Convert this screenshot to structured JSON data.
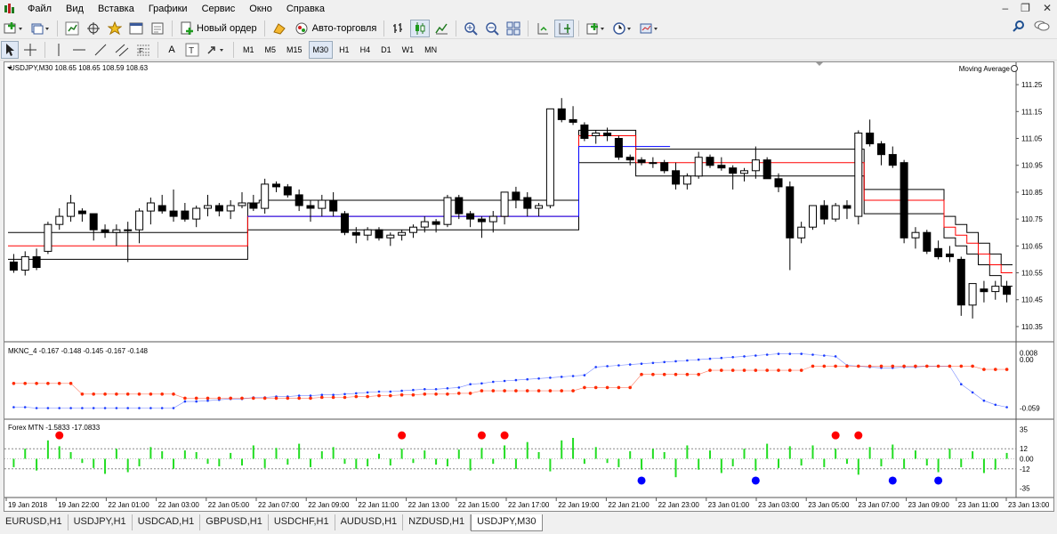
{
  "menu": [
    "Файл",
    "Вид",
    "Вставка",
    "Графики",
    "Сервис",
    "Окно",
    "Справка"
  ],
  "toolbar": {
    "new_order": "Новый ордер",
    "auto_trading": "Авто-торговля",
    "drawing_text": "A",
    "timeframes": [
      "M1",
      "M5",
      "M15",
      "M30",
      "H1",
      "H4",
      "D1",
      "W1",
      "MN"
    ],
    "active_timeframe": "M30"
  },
  "chart": {
    "header": "USDJPY,M30  108.65 108.65 108.59 108.63",
    "indicator_label": "Moving Average",
    "sub1_header": "MKNC_4 -0.167 -0.148 -0.145 -0.167 -0.148",
    "sub2_header": "Forex MTN -1.5833 -17.0833",
    "price_labels": [
      "111.25",
      "111.15",
      "111.05",
      "110.95",
      "110.85",
      "110.75",
      "110.65",
      "110.55",
      "110.45",
      "110.35"
    ],
    "sub1_labels": [
      "0.008",
      "0.00",
      "-0.059"
    ],
    "sub2_labels": [
      "35",
      "12",
      "0.00",
      "-12",
      "-35"
    ],
    "time_labels": [
      "19 Jan 2018",
      "19 Jan 22:00",
      "22 Jan 01:00",
      "22 Jan 03:00",
      "22 Jan 05:00",
      "22 Jan 07:00",
      "22 Jan 09:00",
      "22 Jan 11:00",
      "22 Jan 13:00",
      "22 Jan 15:00",
      "22 Jan 17:00",
      "22 Jan 19:00",
      "22 Jan 21:00",
      "22 Jan 23:00",
      "23 Jan 01:00",
      "23 Jan 03:00",
      "23 Jan 05:00",
      "23 Jan 07:00",
      "23 Jan 09:00",
      "23 Jan 11:00",
      "23 Jan 13:00"
    ],
    "colors": {
      "bull": "#ffffff",
      "bear": "#000000",
      "ma_mid": "#ff0000",
      "ma_mid2": "#0000ff",
      "band": "#000000",
      "red_dot": "#ff2a00",
      "blue_dot": "#1a3bff",
      "hist": "#22dd22",
      "signal_up": "#ff0000",
      "signal_down": "#0000ff"
    }
  },
  "chart_data": {
    "type": "candlestick",
    "ylim": [
      110.32,
      111.3
    ],
    "candles": [
      [
        110.59,
        110.62,
        110.55,
        110.56
      ],
      [
        110.56,
        110.63,
        110.54,
        110.61
      ],
      [
        110.61,
        110.64,
        110.56,
        110.57
      ],
      [
        110.63,
        110.74,
        110.62,
        110.73
      ],
      [
        110.73,
        110.79,
        110.71,
        110.76
      ],
      [
        110.76,
        110.84,
        110.74,
        110.81
      ],
      [
        110.78,
        110.79,
        110.74,
        110.77
      ],
      [
        110.77,
        110.77,
        110.67,
        110.71
      ],
      [
        110.71,
        110.73,
        110.68,
        110.7
      ],
      [
        110.7,
        110.73,
        110.65,
        110.71
      ],
      [
        110.71,
        110.74,
        110.59,
        110.71
      ],
      [
        110.71,
        110.79,
        110.66,
        110.78
      ],
      [
        110.78,
        110.83,
        110.73,
        110.81
      ],
      [
        110.8,
        110.84,
        110.77,
        110.78
      ],
      [
        110.78,
        110.86,
        110.74,
        110.76
      ],
      [
        110.78,
        110.81,
        110.74,
        110.75
      ],
      [
        110.75,
        110.8,
        110.72,
        110.79
      ],
      [
        110.79,
        110.84,
        110.76,
        110.8
      ],
      [
        110.8,
        110.81,
        110.76,
        110.78
      ],
      [
        110.78,
        110.82,
        110.75,
        110.8
      ],
      [
        110.8,
        110.85,
        110.79,
        110.81
      ],
      [
        110.81,
        110.84,
        110.78,
        110.79
      ],
      [
        110.79,
        110.9,
        110.77,
        110.88
      ],
      [
        110.88,
        110.89,
        110.85,
        110.87
      ],
      [
        110.87,
        110.88,
        110.83,
        110.84
      ],
      [
        110.84,
        110.86,
        110.78,
        110.8
      ],
      [
        110.8,
        110.82,
        110.74,
        110.79
      ],
      [
        110.79,
        110.84,
        110.76,
        110.82
      ],
      [
        110.82,
        110.85,
        110.76,
        110.78
      ],
      [
        110.77,
        110.78,
        110.69,
        110.7
      ],
      [
        110.7,
        110.72,
        110.66,
        110.69
      ],
      [
        110.69,
        110.72,
        110.67,
        110.71
      ],
      [
        110.71,
        110.72,
        110.67,
        110.68
      ],
      [
        110.68,
        110.7,
        110.65,
        110.69
      ],
      [
        110.69,
        110.71,
        110.67,
        110.7
      ],
      [
        110.7,
        110.73,
        110.68,
        110.72
      ],
      [
        110.72,
        110.76,
        110.7,
        110.74
      ],
      [
        110.74,
        110.75,
        110.7,
        110.73
      ],
      [
        110.73,
        110.84,
        110.72,
        110.83
      ],
      [
        110.83,
        110.84,
        110.75,
        110.77
      ],
      [
        110.77,
        110.78,
        110.72,
        110.75
      ],
      [
        110.75,
        110.76,
        110.68,
        110.74
      ],
      [
        110.74,
        110.78,
        110.7,
        110.76
      ],
      [
        110.76,
        110.85,
        110.73,
        110.85
      ],
      [
        110.85,
        110.87,
        110.79,
        110.82
      ],
      [
        110.83,
        110.85,
        110.76,
        110.79
      ],
      [
        110.79,
        110.81,
        110.76,
        110.8
      ],
      [
        110.8,
        111.16,
        110.79,
        111.16
      ],
      [
        111.16,
        111.2,
        111.11,
        111.12
      ],
      [
        111.12,
        111.17,
        111.1,
        111.11
      ],
      [
        111.1,
        111.11,
        111.04,
        111.05
      ],
      [
        111.06,
        111.08,
        111.03,
        111.07
      ],
      [
        111.07,
        111.09,
        111.04,
        111.06
      ],
      [
        111.05,
        111.06,
        110.97,
        110.98
      ],
      [
        110.98,
        110.99,
        110.95,
        110.97
      ],
      [
        110.97,
        110.98,
        110.95,
        110.96
      ],
      [
        110.96,
        110.98,
        110.94,
        110.96
      ],
      [
        110.96,
        110.97,
        110.92,
        110.93
      ],
      [
        110.93,
        110.96,
        110.86,
        110.88
      ],
      [
        110.88,
        110.92,
        110.86,
        110.91
      ],
      [
        110.91,
        111.0,
        110.9,
        110.98
      ],
      [
        110.98,
        110.99,
        110.94,
        110.95
      ],
      [
        110.95,
        110.98,
        110.93,
        110.94
      ],
      [
        110.94,
        110.95,
        110.86,
        110.92
      ],
      [
        110.92,
        110.94,
        110.89,
        110.93
      ],
      [
        110.93,
        111.02,
        110.9,
        110.97
      ],
      [
        110.97,
        110.98,
        110.91,
        110.9
      ],
      [
        110.9,
        110.92,
        110.85,
        110.87
      ],
      [
        110.87,
        110.89,
        110.56,
        110.68
      ],
      [
        110.68,
        110.74,
        110.66,
        110.72
      ],
      [
        110.72,
        110.8,
        110.71,
        110.8
      ],
      [
        110.8,
        110.82,
        110.73,
        110.75
      ],
      [
        110.75,
        110.81,
        110.74,
        110.8
      ],
      [
        110.8,
        110.82,
        110.75,
        110.79
      ],
      [
        110.76,
        111.08,
        110.73,
        111.07
      ],
      [
        111.07,
        111.12,
        111.02,
        111.03
      ],
      [
        111.03,
        111.04,
        110.95,
        110.99
      ],
      [
        110.99,
        111.02,
        110.94,
        110.95
      ],
      [
        110.96,
        110.97,
        110.66,
        110.68
      ],
      [
        110.68,
        110.72,
        110.64,
        110.7
      ],
      [
        110.7,
        110.71,
        110.62,
        110.63
      ],
      [
        110.64,
        110.67,
        110.6,
        110.61
      ],
      [
        110.62,
        110.65,
        110.59,
        110.61
      ],
      [
        110.6,
        110.61,
        110.39,
        110.43
      ],
      [
        110.43,
        110.51,
        110.38,
        110.51
      ],
      [
        110.49,
        110.52,
        110.44,
        110.48
      ],
      [
        110.48,
        110.52,
        110.45,
        110.5
      ],
      [
        110.5,
        110.52,
        110.44,
        110.47
      ]
    ],
    "ma_bands": {
      "upper": [
        110.7,
        110.7,
        110.7,
        110.7,
        110.7,
        110.7,
        110.7,
        110.7,
        110.7,
        110.7,
        110.7,
        110.7,
        110.7,
        110.7,
        110.7,
        110.7,
        110.7,
        110.7,
        110.7,
        110.7,
        110.7,
        110.81,
        110.82,
        110.82,
        110.82,
        110.82,
        110.82,
        110.82,
        110.82,
        110.82,
        110.82,
        110.82,
        110.82,
        110.82,
        110.82,
        110.82,
        110.82,
        110.82,
        110.82,
        110.82,
        110.82,
        110.82,
        110.82,
        110.82,
        110.82,
        110.82,
        110.82,
        110.82,
        110.82,
        110.82,
        111.08,
        111.08,
        111.08,
        111.08,
        111.08,
        111.01,
        111.01,
        111.01,
        111.01,
        111.01,
        111.01,
        111.01,
        111.01,
        111.01,
        111.01,
        111.01,
        111.01,
        111.01,
        111.01,
        111.01,
        111.01,
        111.01,
        111.01,
        111.01,
        111.01,
        110.86,
        110.86,
        110.86,
        110.86,
        110.86,
        110.86,
        110.86,
        110.76,
        110.73,
        110.7,
        110.66,
        110.62,
        110.58
      ],
      "mid_red": [
        110.65,
        110.65,
        110.65,
        110.65,
        110.65,
        110.65,
        110.65,
        110.65,
        110.65,
        110.65,
        110.65,
        110.65,
        110.65,
        110.65,
        110.65,
        110.65,
        110.65,
        110.65,
        110.65,
        110.65,
        110.65,
        110.76,
        110.76,
        110.76,
        110.76,
        110.76,
        110.76,
        110.76,
        110.76,
        110.76,
        110.76,
        110.76,
        110.76,
        110.76,
        110.76,
        110.76,
        110.76,
        110.76,
        110.76,
        110.76,
        110.76,
        110.76,
        110.76,
        110.76,
        110.76,
        110.76,
        110.76,
        110.76,
        110.76,
        110.76,
        111.06,
        111.06,
        111.06,
        111.06,
        111.06,
        110.96,
        110.96,
        110.96,
        110.96,
        110.96,
        110.96,
        110.96,
        110.96,
        110.96,
        110.96,
        110.96,
        110.96,
        110.96,
        110.96,
        110.96,
        110.96,
        110.96,
        110.96,
        110.96,
        110.96,
        110.82,
        110.82,
        110.82,
        110.82,
        110.82,
        110.82,
        110.82,
        110.72,
        110.69,
        110.66,
        110.62,
        110.58,
        110.55
      ],
      "mid_blue": [
        null,
        null,
        null,
        null,
        null,
        null,
        null,
        null,
        null,
        null,
        null,
        null,
        null,
        null,
        null,
        null,
        null,
        null,
        null,
        null,
        null,
        110.76,
        110.76,
        110.76,
        110.76,
        110.76,
        110.76,
        110.76,
        110.76,
        110.76,
        110.76,
        110.76,
        110.76,
        110.76,
        110.76,
        110.76,
        110.76,
        110.76,
        110.76,
        110.76,
        110.76,
        110.76,
        110.76,
        110.76,
        110.76,
        110.76,
        110.76,
        110.76,
        110.76,
        110.76,
        111.02,
        111.02,
        111.02,
        111.02,
        111.02,
        111.02,
        111.02,
        111.02,
        null,
        null,
        null,
        null,
        null,
        null,
        null,
        null,
        null,
        null,
        null,
        null,
        null,
        null,
        null,
        null,
        null,
        null,
        null,
        null,
        null,
        null,
        null,
        null,
        null,
        null,
        null,
        null,
        null,
        null
      ],
      "lower": [
        110.6,
        110.6,
        110.6,
        110.6,
        110.6,
        110.6,
        110.6,
        110.6,
        110.6,
        110.6,
        110.6,
        110.6,
        110.6,
        110.6,
        110.6,
        110.6,
        110.6,
        110.6,
        110.6,
        110.6,
        110.6,
        110.71,
        110.71,
        110.71,
        110.71,
        110.71,
        110.71,
        110.71,
        110.71,
        110.71,
        110.71,
        110.71,
        110.71,
        110.71,
        110.71,
        110.71,
        110.71,
        110.71,
        110.71,
        110.71,
        110.71,
        110.71,
        110.71,
        110.71,
        110.71,
        110.71,
        110.71,
        110.71,
        110.71,
        110.71,
        110.96,
        110.96,
        110.96,
        110.96,
        110.96,
        110.91,
        110.91,
        110.91,
        110.91,
        110.91,
        110.91,
        110.91,
        110.91,
        110.91,
        110.91,
        110.91,
        110.91,
        110.91,
        110.91,
        110.91,
        110.91,
        110.91,
        110.91,
        110.91,
        110.91,
        110.77,
        110.77,
        110.77,
        110.77,
        110.77,
        110.77,
        110.77,
        110.68,
        110.65,
        110.62,
        110.58,
        110.54,
        110.5
      ]
    },
    "sub1": {
      "ylim": [
        -0.065,
        0.012
      ],
      "red": [
        -0.029,
        -0.029,
        -0.029,
        -0.029,
        -0.029,
        -0.029,
        -0.042,
        -0.042,
        -0.042,
        -0.042,
        -0.042,
        -0.042,
        -0.042,
        -0.042,
        -0.042,
        -0.047,
        -0.047,
        -0.047,
        -0.047,
        -0.047,
        -0.047,
        -0.047,
        -0.047,
        -0.047,
        -0.047,
        -0.047,
        -0.047,
        -0.046,
        -0.046,
        -0.046,
        -0.045,
        -0.045,
        -0.044,
        -0.044,
        -0.043,
        -0.043,
        -0.042,
        -0.042,
        -0.042,
        -0.041,
        -0.041,
        -0.038,
        -0.038,
        -0.038,
        -0.038,
        -0.038,
        -0.038,
        -0.038,
        -0.038,
        -0.038,
        -0.034,
        -0.034,
        -0.034,
        -0.034,
        -0.034,
        -0.018,
        -0.018,
        -0.018,
        -0.018,
        -0.018,
        -0.018,
        -0.013,
        -0.013,
        -0.013,
        -0.013,
        -0.013,
        -0.013,
        -0.013,
        -0.013,
        -0.013,
        -0.008,
        -0.008,
        -0.008,
        -0.008,
        -0.008,
        -0.008,
        -0.008,
        -0.008,
        -0.008,
        -0.008,
        -0.008,
        -0.008,
        -0.008,
        -0.008,
        -0.008,
        -0.012,
        -0.012,
        -0.012
      ],
      "blue": [
        -0.058,
        -0.058,
        -0.059,
        -0.059,
        -0.059,
        -0.059,
        -0.059,
        -0.059,
        -0.059,
        -0.059,
        -0.059,
        -0.059,
        -0.059,
        -0.059,
        -0.059,
        -0.051,
        -0.051,
        -0.05,
        -0.049,
        -0.048,
        -0.048,
        -0.046,
        -0.046,
        -0.045,
        -0.045,
        -0.044,
        -0.044,
        -0.043,
        -0.043,
        -0.042,
        -0.041,
        -0.04,
        -0.039,
        -0.039,
        -0.038,
        -0.037,
        -0.036,
        -0.036,
        -0.035,
        -0.034,
        -0.03,
        -0.029,
        -0.027,
        -0.026,
        -0.025,
        -0.024,
        -0.023,
        -0.022,
        -0.021,
        -0.02,
        -0.019,
        -0.009,
        -0.008,
        -0.007,
        -0.006,
        -0.005,
        -0.004,
        -0.003,
        -0.002,
        -0.001,
        0.0,
        0.001,
        0.002,
        0.003,
        0.004,
        0.005,
        0.006,
        0.007,
        0.007,
        0.007,
        0.006,
        0.005,
        0.004,
        -0.007,
        -0.008,
        -0.009,
        -0.01,
        -0.01,
        -0.009,
        -0.009,
        -0.008,
        -0.008,
        -0.008,
        -0.03,
        -0.04,
        -0.05,
        -0.055,
        -0.058
      ]
    },
    "sub2": {
      "ylim": [
        -42,
        42
      ],
      "hist": [
        -10,
        12,
        -14,
        22,
        15,
        8,
        -5,
        -11,
        -18,
        12,
        -16,
        -9,
        14,
        9,
        -12,
        10,
        8,
        -6,
        -9,
        7,
        -8,
        16,
        -11,
        13,
        -7,
        18,
        -10,
        9,
        14,
        -6,
        -12,
        -9,
        6,
        -8,
        12,
        -5,
        10,
        -7,
        -9,
        11,
        -14,
        13,
        -6,
        16,
        -12,
        20,
        8,
        -15,
        22,
        25,
        -6,
        14,
        -5,
        -10,
        9,
        -13,
        12,
        8,
        -22,
        16,
        -13,
        10,
        -17,
        -9,
        12,
        -14,
        18,
        -11,
        15,
        -8,
        16,
        -10,
        12,
        -6,
        -19,
        14,
        -9,
        17,
        -12,
        10,
        -8,
        -16,
        12,
        -10,
        9,
        -17,
        -13,
        7
      ],
      "up_signals": [
        4,
        34,
        41,
        43,
        72,
        74
      ],
      "down_signals": [
        55,
        65,
        77,
        81
      ],
      "levels": [
        35,
        12,
        0,
        -12,
        -35
      ]
    }
  },
  "tabs": [
    "EURUSD,H1",
    "USDJPY,H1",
    "USDCAD,H1",
    "GBPUSD,H1",
    "USDCHF,H1",
    "AUDUSD,H1",
    "NZDUSD,H1",
    "USDJPY,M30"
  ],
  "active_tab": "USDJPY,M30"
}
